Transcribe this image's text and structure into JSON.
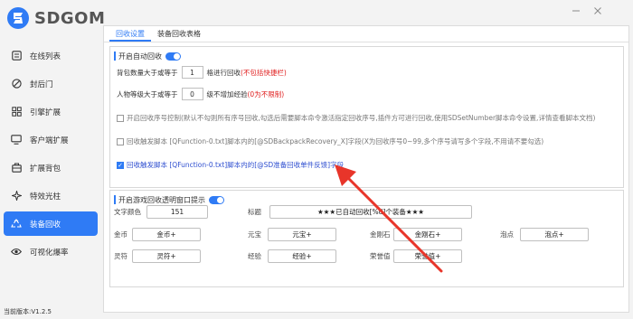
{
  "app": {
    "name": "SDGOM",
    "version": "当前版本:V1.2.5"
  },
  "sidebar": {
    "items": [
      {
        "label": "在线列表",
        "icon": "list-icon",
        "active": false
      },
      {
        "label": "封后门",
        "icon": "block-icon",
        "active": false
      },
      {
        "label": "引擎扩展",
        "icon": "grid-icon",
        "active": false
      },
      {
        "label": "客户端扩展",
        "icon": "monitor-icon",
        "active": false
      },
      {
        "label": "扩展背包",
        "icon": "bag-icon",
        "active": false
      },
      {
        "label": "特效光柱",
        "icon": "sparkle-icon",
        "active": false
      },
      {
        "label": "装备回收",
        "icon": "recycle-icon",
        "active": true
      },
      {
        "label": "可视化爆率",
        "icon": "eye-icon",
        "active": false
      }
    ]
  },
  "tabs": [
    {
      "label": "回收设置",
      "active": true
    },
    {
      "label": "装备回收表格",
      "active": false
    }
  ],
  "auto_recycle": {
    "title": "开启自动回收",
    "enabled": true,
    "bag_row": {
      "prefix": "背包数量大于或等于",
      "value": "1",
      "suffix": "格进行回收",
      "note": "(不包括快捷栏)"
    },
    "level_row": {
      "prefix": "人物等级大于或等于",
      "value": "0",
      "suffix": "级不增加经验",
      "note": "(0为不限制)"
    },
    "options": [
      {
        "checked": false,
        "text": "开启回收序号控制(默认不勾则所有序号回收,勾选后需要脚本命令激活指定回收序号,插件方可进行回收,使用SDSetNumber脚本命令设置,详情查看脚本文档)"
      },
      {
        "checked": false,
        "text": "回收触发脚本 [QFunction-0.txt]脚本内的[@SDBackpackRecovery_X]字段(X为回收序号0~99,多个序号请写多个字段,不用请不要勾选)"
      },
      {
        "checked": true,
        "text": "回收触发脚本 [QFunction-0.txt]脚本内的[@SD准备回收单件反馈]字段"
      }
    ]
  },
  "popup": {
    "title": "开启游戏回收透明窗口提示",
    "enabled": true,
    "text_color_label": "文字颜色",
    "text_color_value": "151",
    "headline_label": "标题",
    "headline_value": "★★★已自动回收[%d]个装备★★★",
    "fields": [
      {
        "label": "金币",
        "value": "金币+"
      },
      {
        "label": "元宝",
        "value": "元宝+"
      },
      {
        "label": "金刚石",
        "value": "金刚石+"
      },
      {
        "label": "泡点",
        "value": "泡点+"
      },
      {
        "label": "灵符",
        "value": "灵符+"
      },
      {
        "label": "经验",
        "value": "经验+"
      },
      {
        "label": "荣誉值",
        "value": "荣誉值+"
      }
    ]
  },
  "colors": {
    "accent": "#2f7bf5",
    "note_red": "#e02020",
    "annotation_arrow": "#e8352a"
  }
}
